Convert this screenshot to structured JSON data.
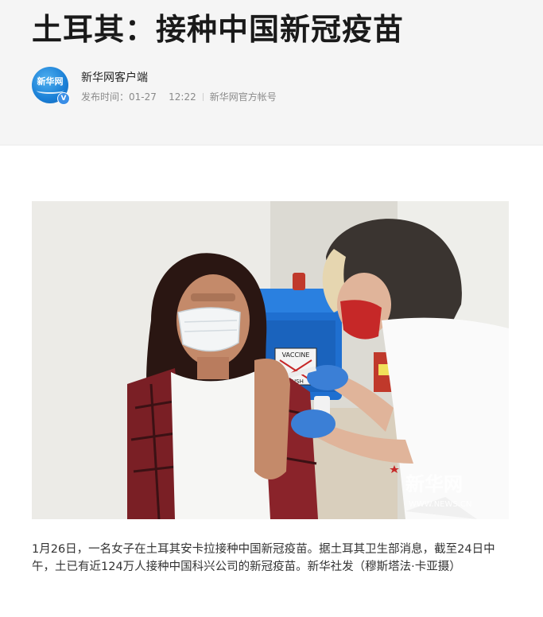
{
  "article": {
    "title": "土耳其：接种中国新冠疫苗",
    "author": {
      "name": "新华网客户端",
      "avatar_text": "新华网",
      "verified_mark": "V"
    },
    "meta": {
      "publish_label": "发布时间：",
      "date": "01-27",
      "time": "12:22",
      "account": "新华网官方帐号"
    },
    "photo": {
      "watermark_cn": "新华网",
      "watermark_url": "WWW.NEWS.CN",
      "box_label": "VACCINE",
      "box_sublabel": "RUSH"
    },
    "caption": "1月26日，一名女子在土耳其安卡拉接种中国新冠疫苗。据土耳其卫生部消息，截至24日中午，土已有近124万人接种中国科兴公司的新冠疫苗。新华社发（穆斯塔法·卡亚摄）"
  },
  "colors": {
    "header_bg": "#f5f5f5",
    "title": "#1a1a1a",
    "avatar_blue": "#1a7fd6",
    "meta_gray": "#8a8a8a"
  }
}
